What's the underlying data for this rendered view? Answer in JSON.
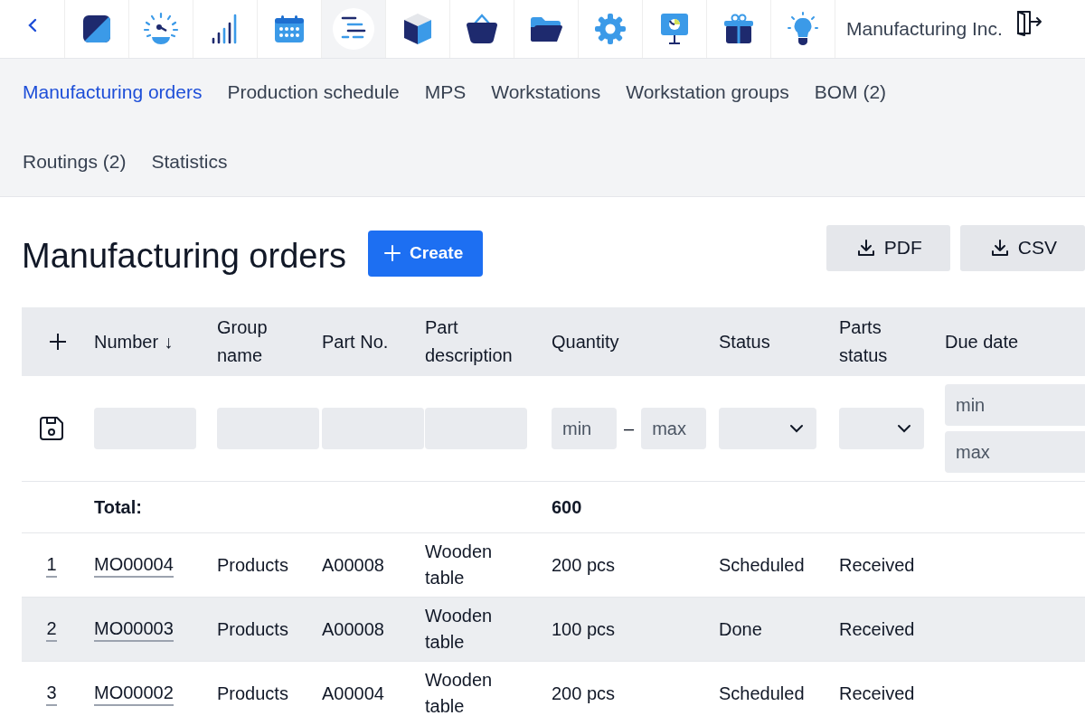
{
  "top_bar": {
    "apps": [
      {
        "kind": "tile",
        "selected": false
      },
      {
        "kind": "gauge",
        "selected": false
      },
      {
        "kind": "signal",
        "selected": false
      },
      {
        "kind": "calendar",
        "selected": false
      },
      {
        "kind": "gantt",
        "selected": true
      },
      {
        "kind": "cube",
        "selected": false
      },
      {
        "kind": "basket",
        "selected": false
      },
      {
        "kind": "folder",
        "selected": false
      },
      {
        "kind": "gear",
        "selected": false
      },
      {
        "kind": "presentation",
        "selected": false
      },
      {
        "kind": "gift",
        "selected": false
      },
      {
        "kind": "bulb",
        "selected": false
      }
    ],
    "company": "Manufacturing Inc."
  },
  "subnav": [
    {
      "label": "Manufacturing orders",
      "selected": true
    },
    {
      "label": "Production schedule",
      "selected": false
    },
    {
      "label": "MPS",
      "selected": false
    },
    {
      "label": "Workstations",
      "selected": false
    },
    {
      "label": "Workstation groups",
      "selected": false
    },
    {
      "label": "BOM (2)",
      "selected": false
    },
    {
      "label": "Routings (2)",
      "selected": false
    },
    {
      "label": "Statistics",
      "selected": false
    }
  ],
  "page_title": "Manufacturing orders",
  "create_button": "Create",
  "export_buttons": [
    "PDF",
    "CSV"
  ],
  "table": {
    "columns": [
      {
        "label": "Number",
        "sort_indicator": "↓"
      },
      {
        "label": "Group name"
      },
      {
        "label": "Part No."
      },
      {
        "label": "Part description"
      },
      {
        "label": "Quantity"
      },
      {
        "label": "Status"
      },
      {
        "label": "Parts status"
      },
      {
        "label": "Due date"
      }
    ],
    "filters": [
      {
        "kind": "text"
      },
      {
        "kind": "text"
      },
      {
        "kind": "text"
      },
      {
        "kind": "text"
      },
      {
        "kind": "range",
        "min_placeholder": "min",
        "separator": "–",
        "max_placeholder": "max"
      },
      {
        "kind": "select"
      },
      {
        "kind": "select"
      },
      {
        "kind": "stacked_range",
        "min_placeholder": "min",
        "max_placeholder": "max"
      }
    ],
    "total": {
      "label": "Total:",
      "quantity": "600"
    },
    "rows": [
      {
        "index": "1",
        "number": "MO00004",
        "group": "Products",
        "part_no": "A00008",
        "description": "Wooden table",
        "quantity": "200 pcs",
        "status": "Scheduled",
        "parts_status": "Received",
        "highlighted": false
      },
      {
        "index": "2",
        "number": "MO00003",
        "group": "Products",
        "part_no": "A00008",
        "description": "Wooden table",
        "quantity": "100 pcs",
        "status": "Done",
        "parts_status": "Received",
        "highlighted": true
      },
      {
        "index": "3",
        "number": "MO00002",
        "group": "Products",
        "part_no": "A00004",
        "description": "Wooden table",
        "quantity": "200 pcs",
        "status": "Scheduled",
        "parts_status": "Received",
        "highlighted": false
      }
    ]
  }
}
